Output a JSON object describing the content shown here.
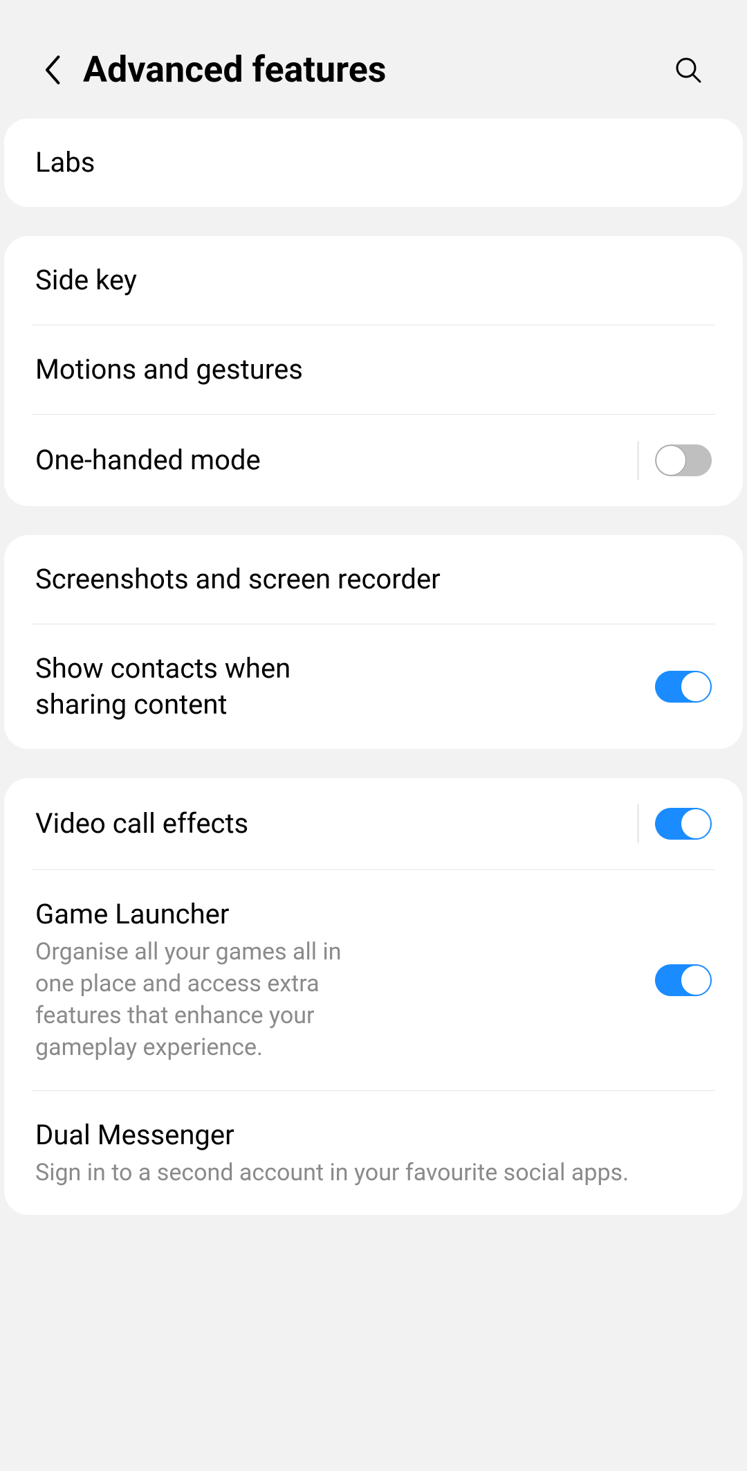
{
  "header": {
    "title": "Advanced features"
  },
  "groups": [
    {
      "items": [
        {
          "id": "labs",
          "label": "Labs"
        }
      ]
    },
    {
      "items": [
        {
          "id": "side-key",
          "label": "Side key"
        },
        {
          "id": "motions-gestures",
          "label": "Motions and gestures"
        },
        {
          "id": "one-handed",
          "label": "One-handed mode",
          "switch": false,
          "vsep": true
        }
      ]
    },
    {
      "items": [
        {
          "id": "screenshots",
          "label": "Screenshots and screen recorder"
        },
        {
          "id": "share-contacts",
          "label": "Show contacts when sharing content",
          "switch": true
        }
      ]
    },
    {
      "items": [
        {
          "id": "video-effects",
          "label": "Video call effects",
          "switch": true,
          "vsep": true
        },
        {
          "id": "game-launcher",
          "label": "Game Launcher",
          "desc": "Organise all your games all in one place and access extra features that enhance your gameplay experience.",
          "switch": true
        },
        {
          "id": "dual-messenger",
          "label": "Dual Messenger",
          "desc": "Sign in to a second account in your favourite social apps."
        }
      ]
    }
  ]
}
